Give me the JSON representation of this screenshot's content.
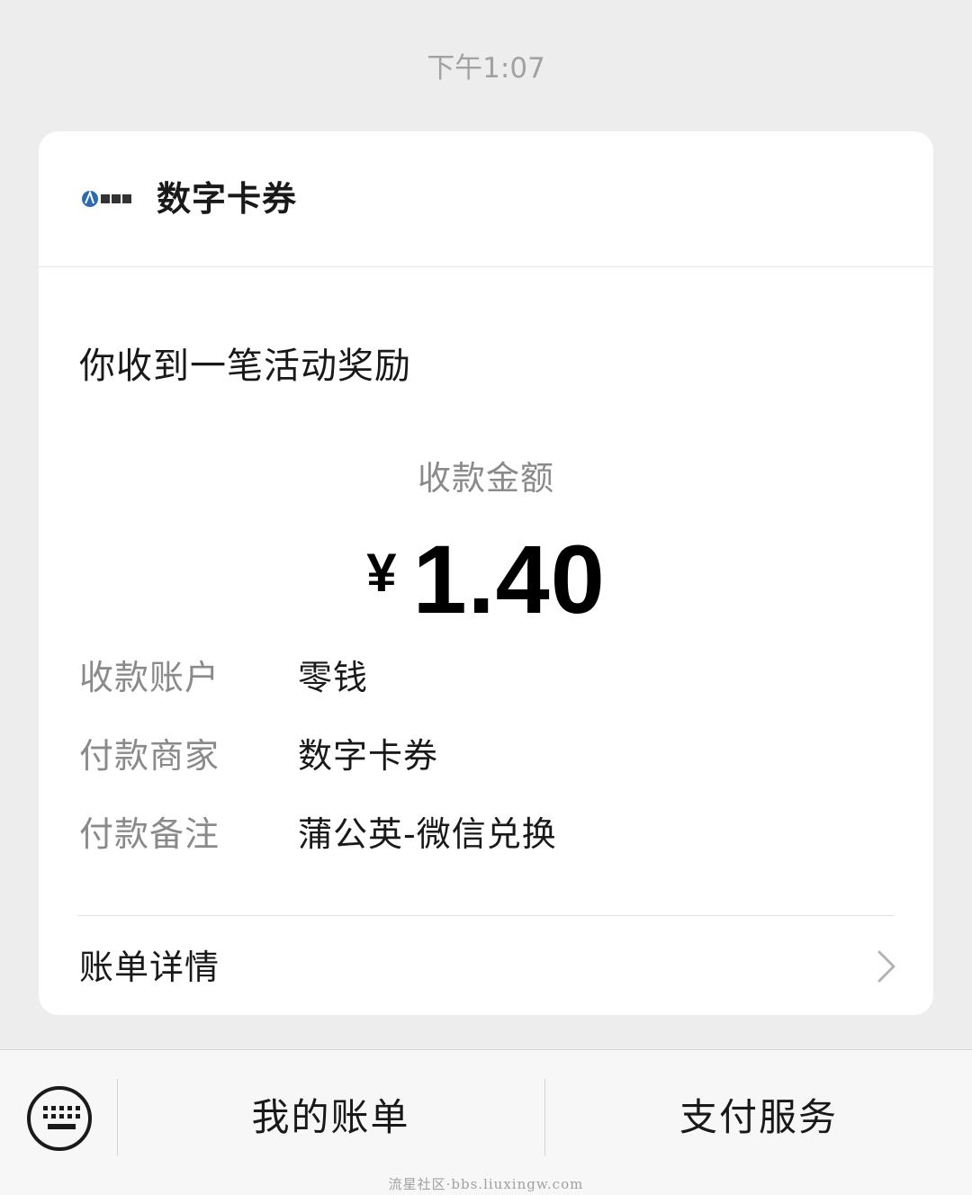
{
  "timestamp": "下午1:07",
  "card": {
    "merchant": {
      "logo_icon": "merchant-logo-icon",
      "name": "数字卡券"
    },
    "headline": "你收到一笔活动奖励",
    "amount_label": "收款金额",
    "currency_symbol": "¥",
    "amount": "1.40",
    "details": [
      {
        "label": "收款账户",
        "value": "零钱"
      },
      {
        "label": "付款商家",
        "value": "数字卡券"
      },
      {
        "label": "付款备注",
        "value": "蒲公英-微信兑换"
      }
    ],
    "bill_detail_label": "账单详情",
    "bill_detail_icon": "chevron-right-icon"
  },
  "bottom_bar": {
    "keyboard_icon": "keyboard-icon",
    "buttons": [
      {
        "label": "我的账单"
      },
      {
        "label": "支付服务"
      }
    ]
  },
  "watermark": "流星社区·bbs.liuxingw.com",
  "colors": {
    "page_background": "#ededed",
    "card_background": "#ffffff",
    "primary_text": "#191919",
    "secondary_text": "#8a8a8a",
    "timestamp_text": "#a2a2a2",
    "bottom_bar_background": "#f7f7f7",
    "logo_blue": "#2b6cb0"
  }
}
